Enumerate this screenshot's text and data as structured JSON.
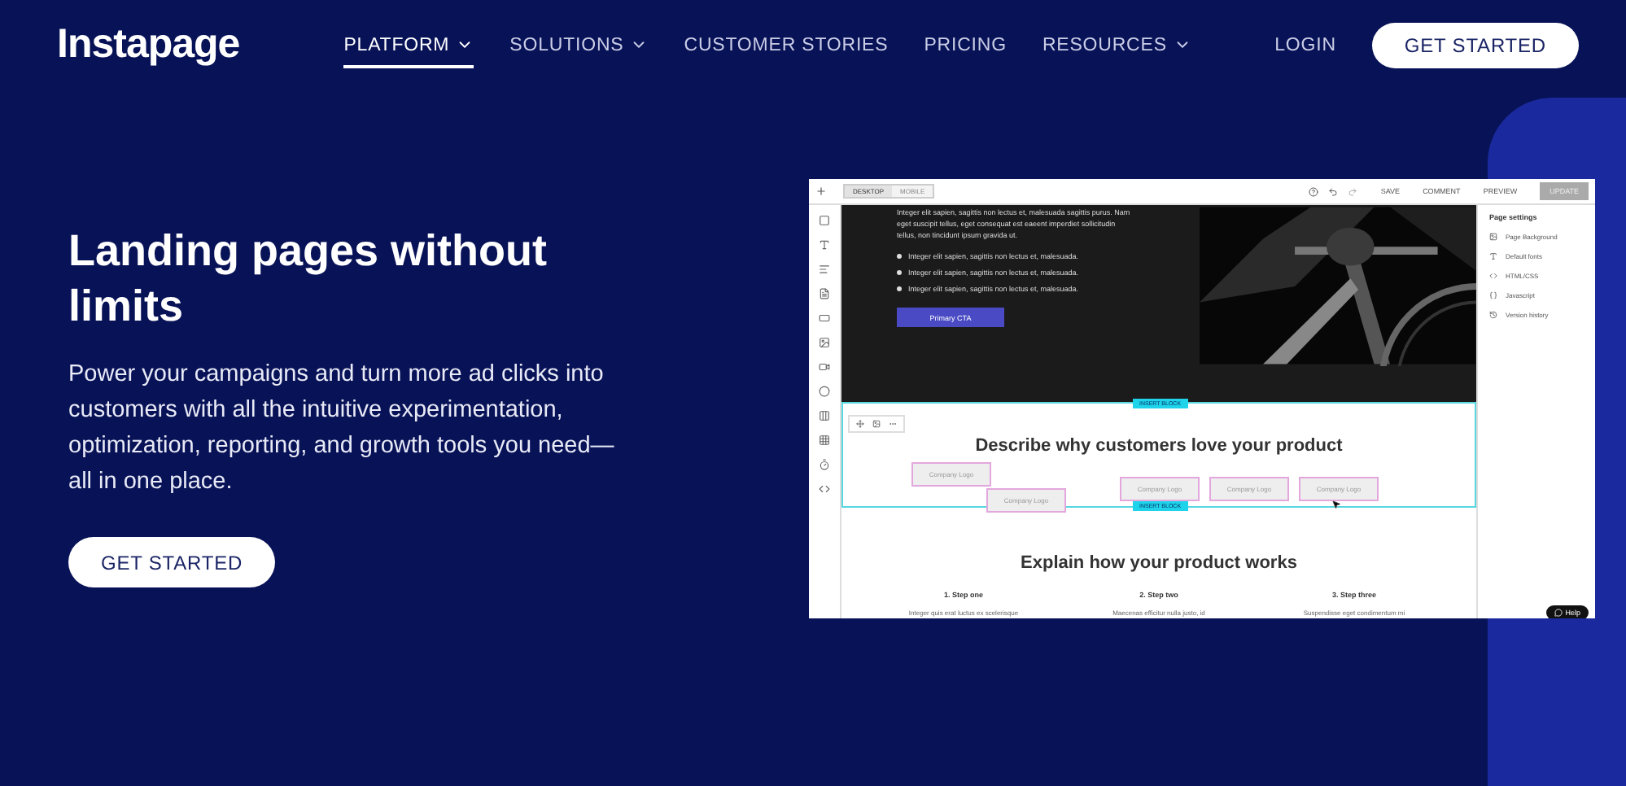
{
  "brand": {
    "logo": "Instapage"
  },
  "nav": {
    "items": [
      {
        "label": "PLATFORM",
        "selected": true,
        "has_menu": true
      },
      {
        "label": "SOLUTIONS",
        "selected": false,
        "has_menu": true
      },
      {
        "label": "CUSTOMER STORIES",
        "selected": false,
        "has_menu": false
      },
      {
        "label": "PRICING",
        "selected": false,
        "has_menu": false
      },
      {
        "label": "RESOURCES",
        "selected": false,
        "has_menu": true
      }
    ],
    "login": "LOGIN",
    "cta": "GET STARTED"
  },
  "hero": {
    "title": "Landing pages without limits",
    "text": "Power your campaigns and turn more ad clicks into customers with all the intuitive experimentation, optimization, reporting, and growth tools you need—all in one place.",
    "button": "GET STARTED"
  },
  "editor": {
    "view_tabs": [
      {
        "label": "DESKTOP",
        "selected": true
      },
      {
        "label": "MOBILE",
        "selected": false
      }
    ],
    "actions": [
      "SAVE",
      "COMMENT",
      "PREVIEW"
    ],
    "update_button": "UPDATE",
    "canvas": {
      "intro": "Integer elit sapien, sagittis non lectus et, malesuada sagittis purus. Nam eget suscipit tellus, eget consequat est eaeent imperdiet sollicitudin tellus, non tincidunt ipsum gravida ut.",
      "bullets": [
        "Integer elit sapien, sagittis non lectus et, malesuada.",
        "Integer elit sapien, sagittis non lectus et, malesuada.",
        "Integer elit sapien, sagittis non lectus et, malesuada."
      ],
      "cta": "Primary CTA",
      "insert_labels": [
        "INSERT BLOCK",
        "INSERT BLOCK"
      ],
      "heading": "Describe why customers love your product",
      "logos": [
        "Company Logo",
        "Company Logo",
        "Company Logo",
        "Company Logo",
        "Company Logo"
      ],
      "heading_2": "Explain how your product works",
      "steps": [
        {
          "title": "1. Step one",
          "text": "Integer quis erat luctus ex scelerisque"
        },
        {
          "title": "2. Step two",
          "text": "Maecenas efficitur nulla justo, id"
        },
        {
          "title": "3. Step three",
          "text": "Suspendisse eget condimentum mi"
        }
      ]
    },
    "panel": {
      "title": "Page settings",
      "items": [
        "Page Background",
        "Default fonts",
        "HTML/CSS",
        "Javascript",
        "Version history"
      ]
    },
    "help": "Help"
  }
}
